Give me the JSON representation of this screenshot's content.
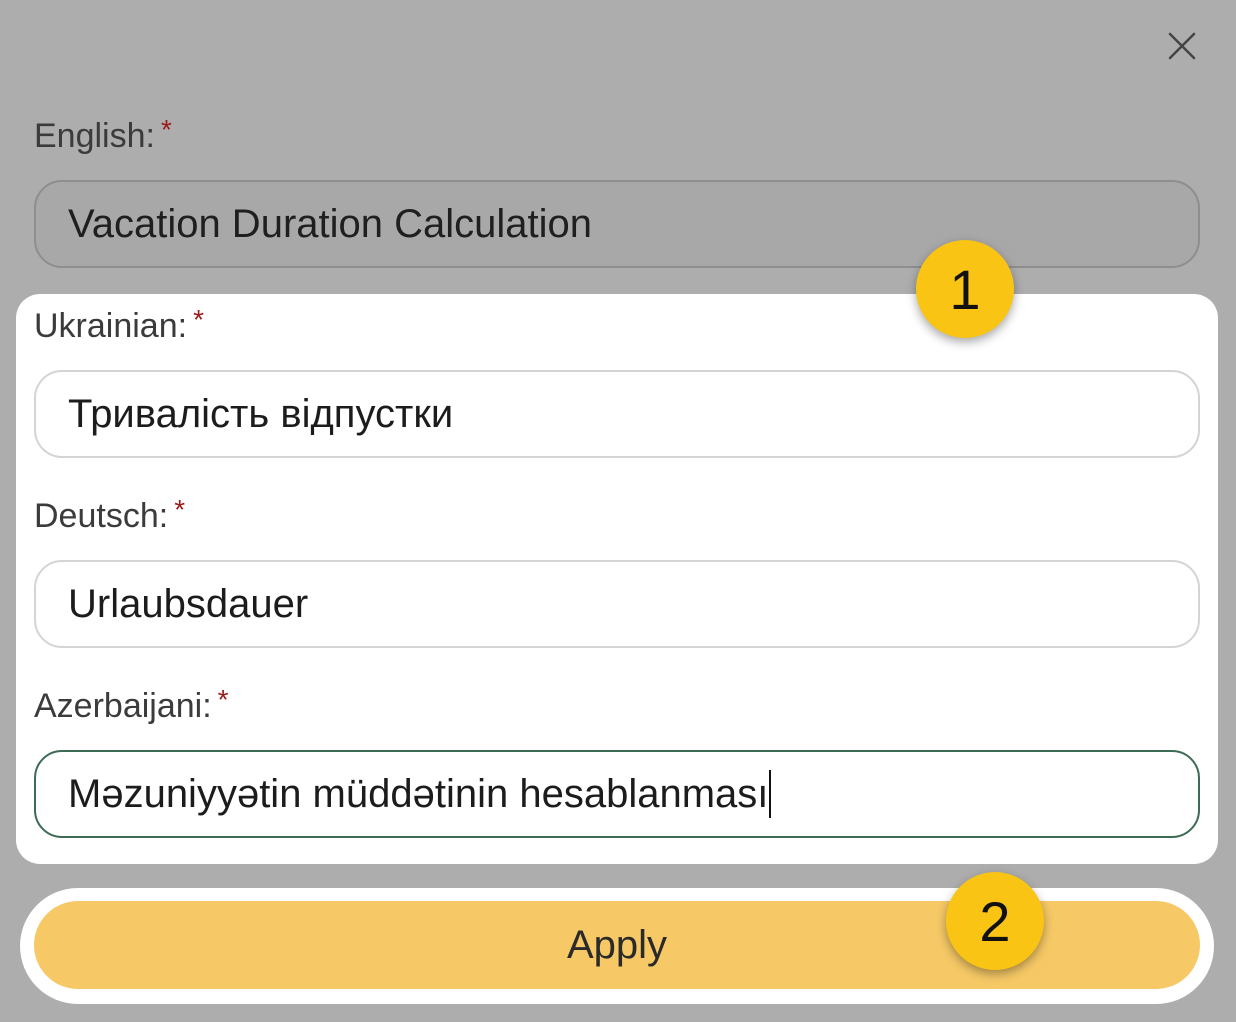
{
  "dialog": {
    "close_icon": "close-icon"
  },
  "fields": {
    "english": {
      "label": "English:",
      "required_mark": "*",
      "value": "Vacation Duration Calculation"
    },
    "ukrainian": {
      "label": "Ukrainian:",
      "required_mark": "*",
      "value": "Тривалість відпустки"
    },
    "deutsch": {
      "label": "Deutsch:",
      "required_mark": "*",
      "value": "Urlaubsdauer"
    },
    "azerbaijani": {
      "label": "Azerbaijani:",
      "required_mark": "*",
      "value": "Məzuniyyətin müddətinin hesablanması"
    }
  },
  "actions": {
    "apply_label": "Apply"
  },
  "annotations": {
    "badge_1": "1",
    "badge_2": "2"
  },
  "colors": {
    "overlay": "#adadad",
    "accent_yellow": "#fac415",
    "apply_button": "#f6c966",
    "required_mark": "#9c1a1a",
    "focus_border": "#3e6b55"
  }
}
